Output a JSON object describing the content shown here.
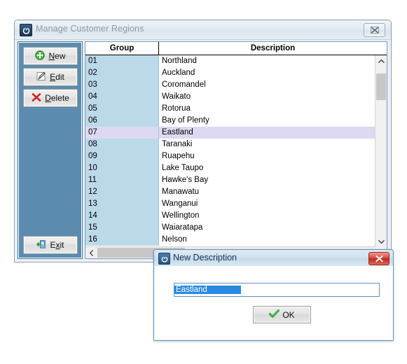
{
  "main_window": {
    "title": "Manage Customer Regions",
    "icon": "power-app-icon",
    "close_label": "☒",
    "sidebar": {
      "buttons": [
        {
          "name": "new",
          "label": "New",
          "accel": "N",
          "icon": "plus-circle-green-icon"
        },
        {
          "name": "edit",
          "label": "Edit",
          "accel": "E",
          "icon": "pencil-pad-icon"
        },
        {
          "name": "delete",
          "label": "Delete",
          "accel": "D",
          "icon": "red-x-icon"
        },
        {
          "name": "exit",
          "label": "Exit",
          "accel": "x",
          "icon": "exit-door-green-icon"
        }
      ]
    },
    "grid": {
      "columns": [
        "Group",
        "Description"
      ],
      "selected_index": 6,
      "rows": [
        {
          "group": "01",
          "description": "Northland"
        },
        {
          "group": "02",
          "description": "Auckland"
        },
        {
          "group": "03",
          "description": "Coromandel"
        },
        {
          "group": "04",
          "description": "Waikato"
        },
        {
          "group": "05",
          "description": "Rotorua"
        },
        {
          "group": "06",
          "description": "Bay of Plenty"
        },
        {
          "group": "07",
          "description": "Eastland"
        },
        {
          "group": "08",
          "description": "Taranaki"
        },
        {
          "group": "09",
          "description": "Ruapehu"
        },
        {
          "group": "10",
          "description": "Lake Taupo"
        },
        {
          "group": "11",
          "description": "Hawke's Bay"
        },
        {
          "group": "12",
          "description": "Manawatu"
        },
        {
          "group": "13",
          "description": "Wanganui"
        },
        {
          "group": "14",
          "description": "Wellington"
        },
        {
          "group": "15",
          "description": "Waiaratapa"
        },
        {
          "group": "16",
          "description": "Nelson"
        }
      ],
      "scroll_up_glyph": "∧",
      "scroll_down_glyph": "∨",
      "scroll_left_glyph": "‹"
    }
  },
  "dialog": {
    "title": "New Description",
    "icon": "power-app-icon",
    "close_label": "✕",
    "input": {
      "value": "Eastland",
      "placeholder": "",
      "selected": true
    },
    "ok_button": {
      "label": "OK",
      "icon": "green-check-icon"
    }
  },
  "colors": {
    "panel_blue": "#5b8cb0",
    "group_cell": "#bcd9ea",
    "selected_row": "#ddd9f2",
    "selection_blue": "#2a8ae0",
    "dialog_border": "#5b93c4",
    "close_red": "#c0392b",
    "accent_green": "#2aa62a"
  }
}
